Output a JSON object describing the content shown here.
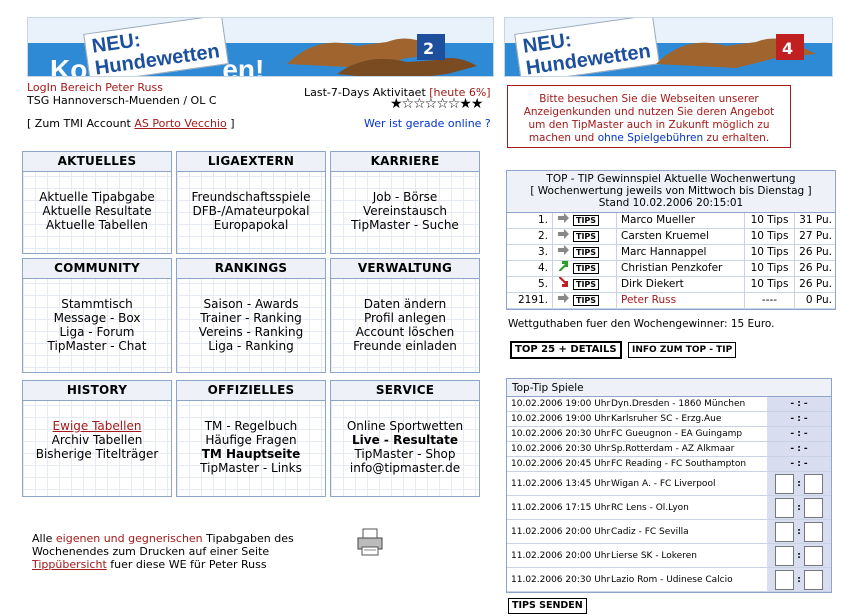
{
  "banners": {
    "neu": "NEU:",
    "title": "Hundewetten",
    "partial": "Ko",
    "excl": "en!"
  },
  "user": {
    "login_label": "LogIn Bereich Peter Russ",
    "club": "TSG Hannoversch-Muenden / OL C",
    "activity_label": "Last-7-Days Aktivitaet",
    "activity_value": "[heute 6%]",
    "stars": "★☆☆☆☆☆★★",
    "account_prefix": "[ Zum TMI Account",
    "account_link": "AS Porto Vecchio",
    "account_suffix": "]",
    "online_link": "Wer ist gerade online ?"
  },
  "notice": {
    "line1": "Bitte besuchen Sie die Webseiten unserer",
    "line2": "Anzeigenkunden und nutzen Sie deren Angebot",
    "line3": "um den TipMaster auch in Zukunft möglich zu",
    "line4a": "machen und",
    "line4b": "ohne Spielgebühren",
    "line4c": "zu erhalten."
  },
  "menu": [
    {
      "title": "AKTUELLES",
      "items": [
        "Aktuelle Tipabgabe",
        "Aktuelle Resultate",
        "Aktuelle Tabellen"
      ]
    },
    {
      "title": "LIGAEXTERN",
      "items": [
        "Freundschaftsspiele",
        "DFB-/Amateurpokal",
        "Europapokal"
      ]
    },
    {
      "title": "KARRIERE",
      "items": [
        "Job - Börse",
        "Vereinstausch",
        "TipMaster - Suche"
      ]
    },
    {
      "title": "COMMUNITY",
      "items": [
        "Stammtisch",
        "Message - Box",
        "Liga - Forum",
        "TipMaster - Chat"
      ]
    },
    {
      "title": "RANKINGS",
      "items": [
        "Saison - Awards",
        "Trainer - Ranking",
        "Vereins - Ranking",
        "Liga - Ranking"
      ]
    },
    {
      "title": "VERWALTUNG",
      "items": [
        "Daten ändern",
        "Profil anlegen",
        "Account löschen",
        "Freunde einladen"
      ]
    },
    {
      "title": "HISTORY",
      "items": [
        "Ewige Tabellen",
        "Archiv Tabellen",
        "Bisherige Titelträger"
      ]
    },
    {
      "title": "OFFIZIELLES",
      "items": [
        "TM - Regelbuch",
        "Häufige Fragen",
        "TM Hauptseite",
        "TipMaster - Links"
      ]
    },
    {
      "title": "SERVICE",
      "items": [
        "Online Sportwetten",
        "Live - Resultate",
        "TipMaster - Shop",
        "info@tipmaster.de"
      ]
    }
  ],
  "print": {
    "p1": "Alle",
    "p2": "eigenen und gegnerischen",
    "p3": "Tipabgaben des",
    "p4": "Wochenendes zum Drucken auf einer Seite",
    "p5": "Tippübersicht",
    "p6": "fuer diese WE für Peter Russ"
  },
  "top": {
    "h1": "TOP - TIP Gewinnspiel Aktuelle Wochenwertung",
    "h2": "[ Wochenwertung jeweils von Mittwoch bis Dienstag ]",
    "h3": "Stand 10.02.2006 20:15:01",
    "tips_label": "TIPS",
    "rows": [
      {
        "rank": "1.",
        "arrow": "right",
        "name": "Marco Mueller",
        "tips": "10 Tips",
        "pts": "31 Pu."
      },
      {
        "rank": "2.",
        "arrow": "right",
        "name": "Carsten Kruemel",
        "tips": "10 Tips",
        "pts": "27 Pu."
      },
      {
        "rank": "3.",
        "arrow": "right",
        "name": "Marc Hannappel",
        "tips": "10 Tips",
        "pts": "26 Pu."
      },
      {
        "rank": "4.",
        "arrow": "up",
        "name": "Christian Penzkofer",
        "tips": "10 Tips",
        "pts": "26 Pu."
      },
      {
        "rank": "5.",
        "arrow": "down",
        "name": "Dirk Diekert",
        "tips": "10 Tips",
        "pts": "26 Pu."
      },
      {
        "rank": "2191.",
        "arrow": "right",
        "name": "Peter Russ",
        "tips": "----",
        "pts": "0 Pu."
      }
    ],
    "prize": "Wettguthaben fuer den Wochengewinner: 15 Euro.",
    "btn_top25": "TOP 25 + DETAILS",
    "btn_info": "INFO ZUM TOP - TIP"
  },
  "games": {
    "title": "Top-Tip Spiele",
    "rows": [
      {
        "date": "10.02.2006 19:00 Uhr",
        "match": "Dyn.Dresden - 1860 München",
        "score": "- : -"
      },
      {
        "date": "10.02.2006 19:00 Uhr",
        "match": "Karlsruher SC - Erzg.Aue",
        "score": "- : -"
      },
      {
        "date": "10.02.2006 20:30 Uhr",
        "match": "FC Gueugnon - EA Guingamp",
        "score": "- : -"
      },
      {
        "date": "10.02.2006 20:30 Uhr",
        "match": "Sp.Rotterdam - AZ Alkmaar",
        "score": "- : -"
      },
      {
        "date": "10.02.2006 20:45 Uhr",
        "match": "FC Reading - FC Southampton",
        "score": "- : -"
      },
      {
        "date": "11.02.2006 13:45 Uhr",
        "match": "Wigan A. - FC Liverpool",
        "score": ""
      },
      {
        "date": "11.02.2006 17:15 Uhr",
        "match": "RC Lens - Ol.Lyon",
        "score": ""
      },
      {
        "date": "11.02.2006 20:00 Uhr",
        "match": "Cadiz - FC Sevilla",
        "score": ""
      },
      {
        "date": "11.02.2006 20:00 Uhr",
        "match": "Lierse SK - Lokeren",
        "score": ""
      },
      {
        "date": "11.02.2006 20:30 Uhr",
        "match": "Lazio Rom - Udinese Calcio",
        "score": ""
      }
    ],
    "colon": ":",
    "send": "TIPS SENDEN"
  }
}
